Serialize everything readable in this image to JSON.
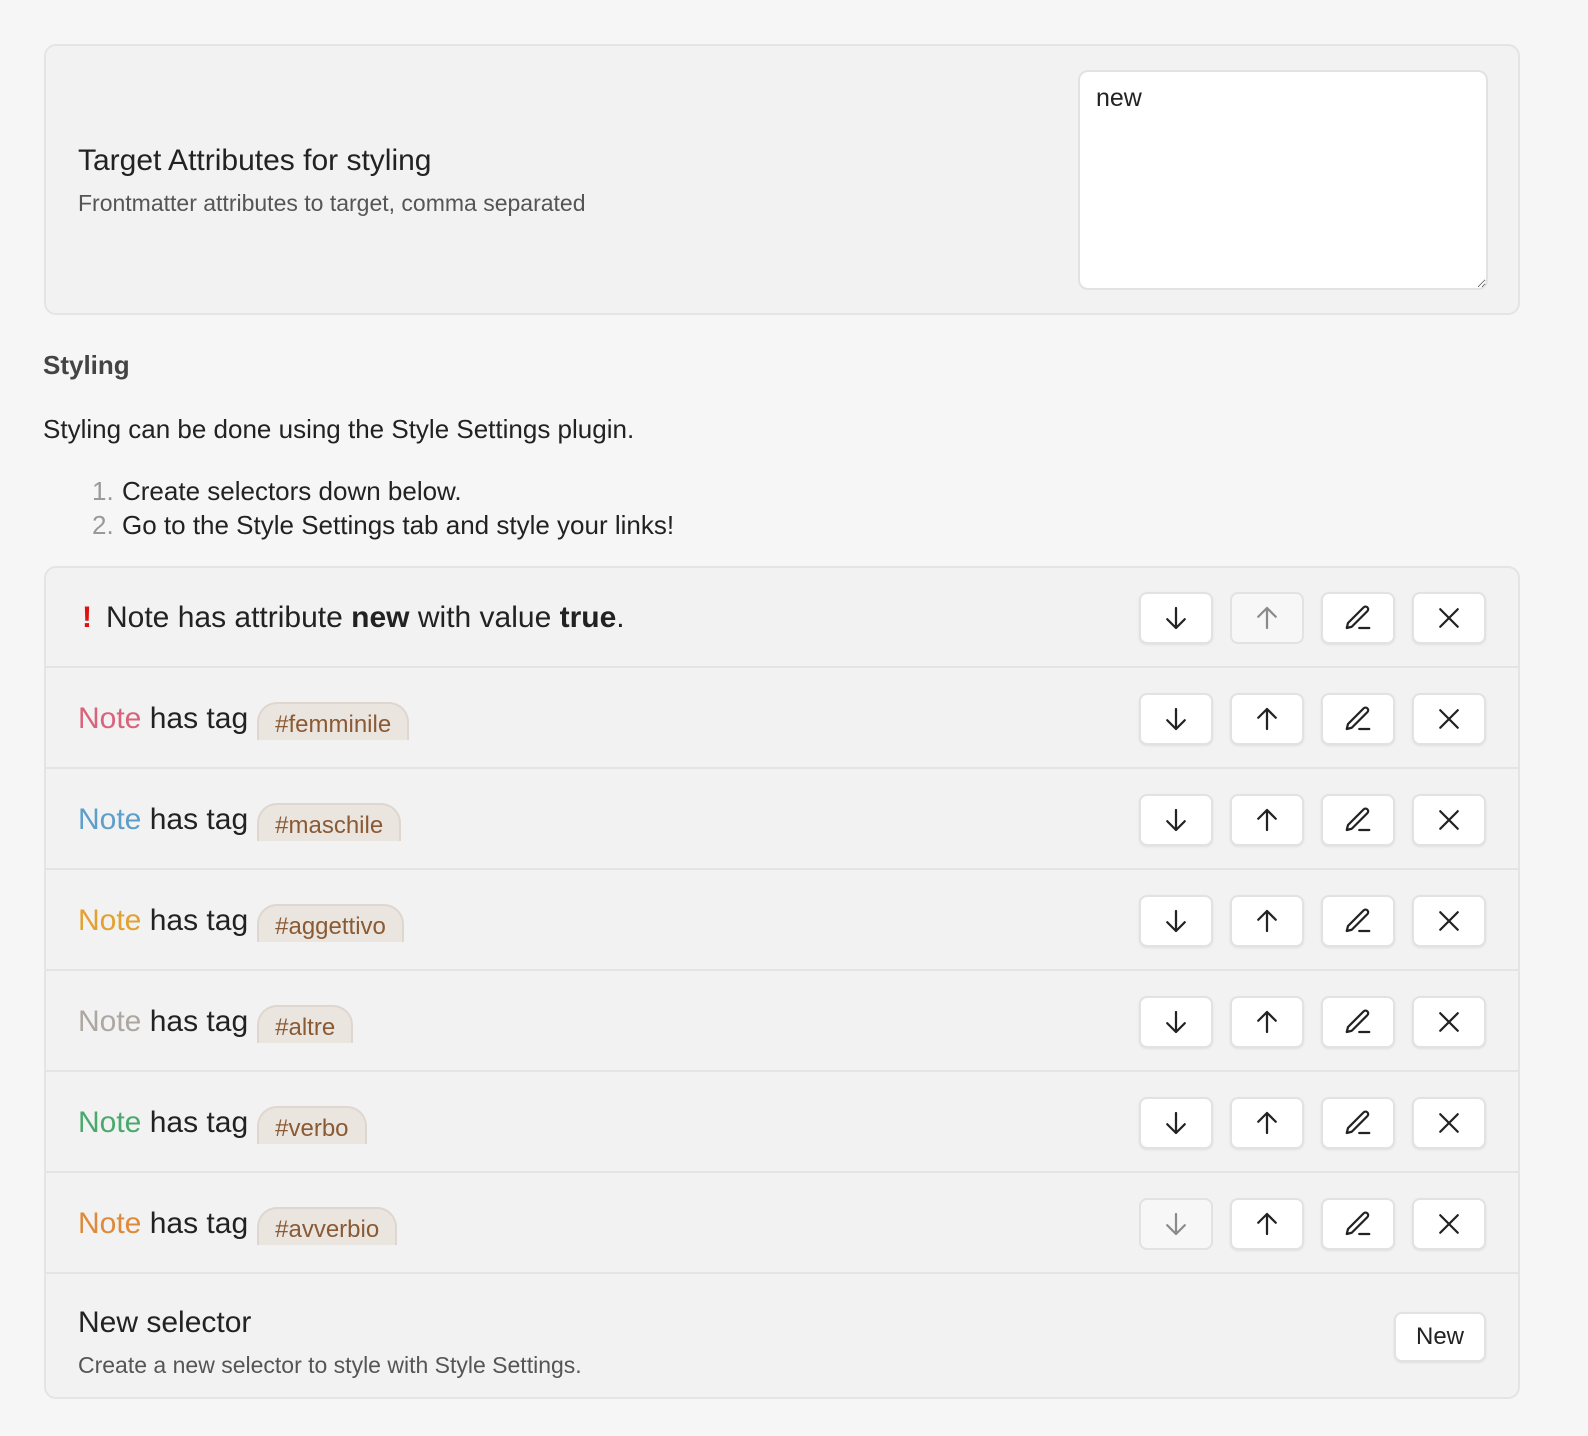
{
  "target_attributes": {
    "name": "Target Attributes for styling",
    "description": "Frontmatter attributes to target, comma separated",
    "value": "new"
  },
  "styling": {
    "heading": "Styling",
    "paragraph": "Styling can be done using the Style Settings plugin.",
    "steps": [
      {
        "num": "1.",
        "text": "Create selectors down below."
      },
      {
        "num": "2.",
        "text": "Go to the Style Settings tab and style your links!"
      }
    ]
  },
  "selectors": {
    "attribute_rule": {
      "icon": "exclamation-icon",
      "prefix": "Note has attribute",
      "attribute": "new",
      "middle": "with value",
      "value": "true",
      "suffix": "."
    },
    "tag_rules": [
      {
        "note": "Note",
        "has_tag": "has tag",
        "tag": "#femminile",
        "color": "#d9637a"
      },
      {
        "note": "Note",
        "has_tag": "has tag",
        "tag": "#maschile",
        "color": "#5c9fc9"
      },
      {
        "note": "Note",
        "has_tag": "has tag",
        "tag": "#aggettivo",
        "color": "#e3a12f"
      },
      {
        "note": "Note",
        "has_tag": "has tag",
        "tag": "#altre",
        "color": "#ada7a2"
      },
      {
        "note": "Note",
        "has_tag": "has tag",
        "tag": "#verbo",
        "color": "#4aa96c"
      },
      {
        "note": "Note",
        "has_tag": "has tag",
        "tag": "#avverbio",
        "color": "#de8a3a"
      }
    ],
    "buttons": [
      "arrow-down-icon",
      "arrow-up-icon",
      "pencil-icon",
      "close-icon"
    ]
  },
  "new_selector": {
    "name": "New selector",
    "description": "Create a new selector to style with Style Settings.",
    "button_label": "New"
  }
}
